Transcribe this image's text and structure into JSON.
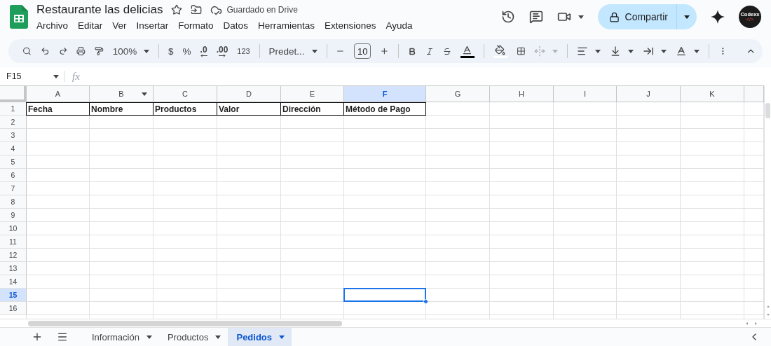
{
  "app": {
    "title": "Restaurante las delicias",
    "save_status": "Guardado en Drive",
    "menu": [
      "Archivo",
      "Editar",
      "Ver",
      "Insertar",
      "Formato",
      "Datos",
      "Herramientas",
      "Extensiones",
      "Ayuda"
    ],
    "share_button": "Compartir",
    "avatar": {
      "text": "Codexx",
      "mark": "</>"
    }
  },
  "toolbar": {
    "zoom": "100%",
    "currency": "$",
    "percent": "%",
    "decrease_decimals": ".0",
    "increase_decimals": ".00",
    "number_format": "123",
    "font": "Predet...",
    "font_size": "10"
  },
  "formula_bar": {
    "cell_ref": "F15",
    "fx": "fx"
  },
  "sheet": {
    "columns": [
      {
        "label": "A",
        "selected": false,
        "menu_caret": false
      },
      {
        "label": "B",
        "selected": false,
        "menu_caret": true
      },
      {
        "label": "C",
        "selected": false,
        "menu_caret": false
      },
      {
        "label": "D",
        "selected": false,
        "menu_caret": false
      },
      {
        "label": "E",
        "selected": false,
        "menu_caret": false
      },
      {
        "label": "F",
        "selected": true,
        "menu_caret": false
      },
      {
        "label": "G",
        "selected": false,
        "menu_caret": false
      },
      {
        "label": "H",
        "selected": false,
        "menu_caret": false
      },
      {
        "label": "I",
        "selected": false,
        "menu_caret": false
      },
      {
        "label": "J",
        "selected": false,
        "menu_caret": false
      },
      {
        "label": "K",
        "selected": false,
        "menu_caret": false
      }
    ],
    "rows": [
      {
        "label": "1",
        "selected": false,
        "cells": [
          "Fecha",
          "Nombre",
          "Productos",
          "Valor",
          "Dirección",
          "Método de Pago"
        ]
      },
      {
        "label": "2",
        "selected": false
      },
      {
        "label": "3",
        "selected": false
      },
      {
        "label": "4",
        "selected": false
      },
      {
        "label": "5",
        "selected": false
      },
      {
        "label": "6",
        "selected": false
      },
      {
        "label": "7",
        "selected": false
      },
      {
        "label": "8",
        "selected": false
      },
      {
        "label": "9",
        "selected": false
      },
      {
        "label": "10",
        "selected": false
      },
      {
        "label": "11",
        "selected": false
      },
      {
        "label": "12",
        "selected": false
      },
      {
        "label": "13",
        "selected": false
      },
      {
        "label": "14",
        "selected": false
      },
      {
        "label": "15",
        "selected": true
      },
      {
        "label": "16",
        "selected": false
      }
    ]
  },
  "tabs": [
    {
      "label": "Información",
      "selected": false
    },
    {
      "label": "Productos",
      "selected": false
    },
    {
      "label": "Pedidos",
      "selected": true
    }
  ]
}
